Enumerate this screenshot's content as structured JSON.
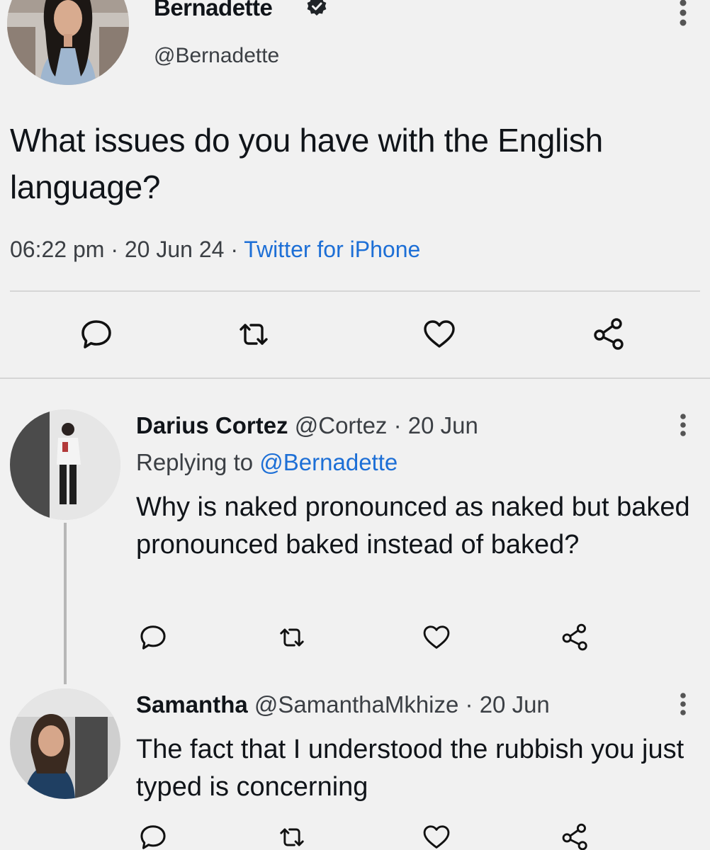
{
  "main_tweet": {
    "author_name": "Bernadette",
    "author_handle": "@Bernadette",
    "verified": true,
    "text": "What issues do you have with the English language?",
    "time": "06:22 pm",
    "date": "20 Jun 24",
    "source": "Twitter for iPhone",
    "separator": "·"
  },
  "replies": [
    {
      "author_name": "Darius Cortez",
      "author_handle": "@Cortez",
      "date": "20 Jun",
      "replying_label": "Replying to",
      "replying_to": "@Bernadette",
      "text": "Why is naked pronounced as naked but baked pronounced baked instead of baked?"
    },
    {
      "author_name": "Samantha",
      "author_handle": "@SamanthaMkhize",
      "date": "20 Jun",
      "text": "The fact that I understood the rubbish you just typed is concerning"
    }
  ],
  "icons": {
    "reply": "comment-icon",
    "retweet": "retweet-icon",
    "like": "heart-icon",
    "share": "share-icon",
    "more": "more-options-icon"
  },
  "colors": {
    "background": "#f1f1f1",
    "text": "#101419",
    "secondary_text": "#3b3f44",
    "link": "#1d6fd6"
  }
}
